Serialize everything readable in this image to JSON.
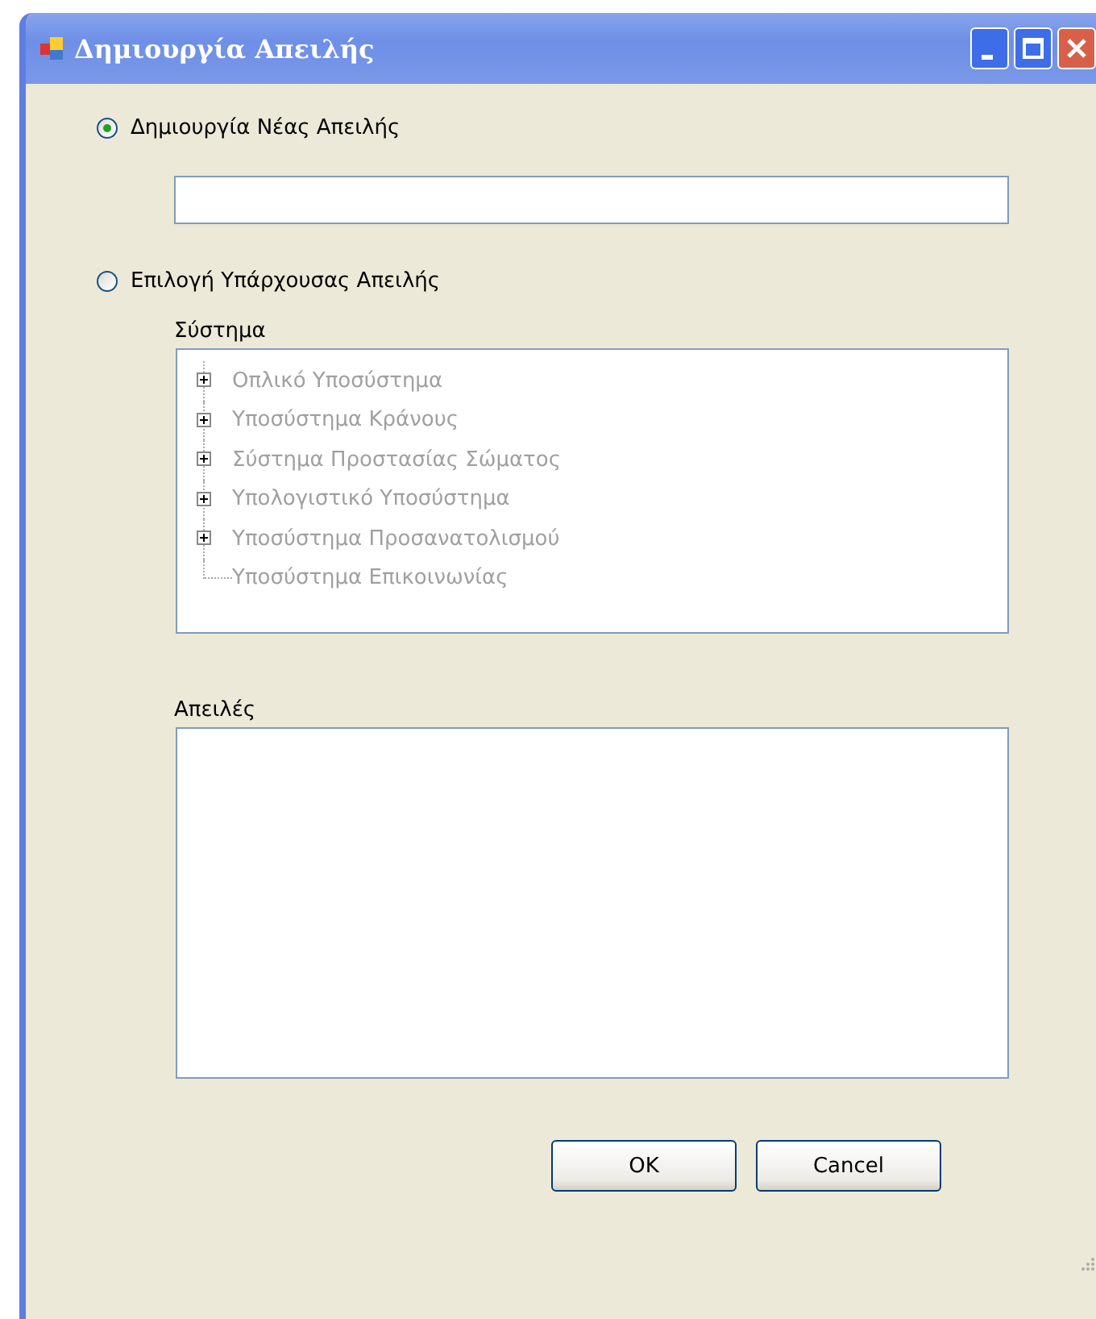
{
  "window": {
    "title": "Δημιουργία Απειλής"
  },
  "options": [
    {
      "label": "Δημιουργία Νέας Απειλής",
      "selected": true
    },
    {
      "label": "Επιλογή Υπάρχουσας Απειλής",
      "selected": false
    }
  ],
  "system": {
    "label": "Σύστημα",
    "disabled": true,
    "items": [
      {
        "label": "Οπλικό Υποσύστημα",
        "kind": "expandable"
      },
      {
        "label": "Υποσύστημα Κράνους",
        "kind": "expandable"
      },
      {
        "label": "Σύστημα Προστασίας Σώματος",
        "kind": "expandable"
      },
      {
        "label": "Υπολογιστικό  Υποσύστημα",
        "kind": "expandable"
      },
      {
        "label": "Υποσύστημα Προσανατολισμού",
        "kind": "expandable"
      },
      {
        "label": "Υποσύστημα Επικοινωνίας",
        "kind": "leaf"
      }
    ]
  },
  "threats": {
    "label": "Απειλές"
  },
  "buttons": [
    {
      "label": "OK"
    },
    {
      "label": "Cancel"
    }
  ]
}
